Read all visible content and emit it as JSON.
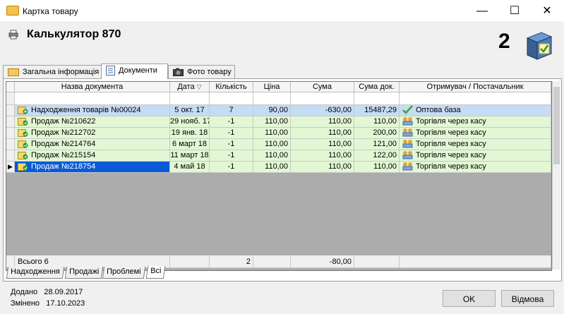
{
  "window": {
    "title": "Картка товару",
    "controls": {
      "minimize": "—",
      "maximize": "☐",
      "close": "✕"
    }
  },
  "product": {
    "name": "Калькулятор 870",
    "stock": "2"
  },
  "tabs": [
    {
      "label": "Загальна інформація",
      "icon": "folder-icon"
    },
    {
      "label": "Документи",
      "icon": "documents-icon",
      "active": true
    },
    {
      "label": "Фото товару",
      "icon": "camera-icon"
    }
  ],
  "grid": {
    "columns": [
      "Назва документа",
      "Дата",
      "Кількість",
      "Ціна",
      "Сума",
      "Сума док.",
      "Отримувач / Постачальник"
    ],
    "sort_indicator": "▽",
    "rows": [
      {
        "doc": "Надходження товарів №00024",
        "date": "5 окт. 17",
        "qty": "7",
        "price": "90,00",
        "sum": "-630,00",
        "doc_sum": "15487,29",
        "party": "Оптова база",
        "kind": "buy"
      },
      {
        "doc": "Продаж №210622",
        "date": "29 нояб. 17",
        "qty": "-1",
        "price": "110,00",
        "sum": "110,00",
        "doc_sum": "110,00",
        "party": "Торгівля через касу",
        "kind": "sale"
      },
      {
        "doc": "Продаж №212702",
        "date": "19 янв. 18",
        "qty": "-1",
        "price": "110,00",
        "sum": "110,00",
        "doc_sum": "200,00",
        "party": "Торгівля через касу",
        "kind": "sale"
      },
      {
        "doc": "Продаж №214764",
        "date": "6 март 18",
        "qty": "-1",
        "price": "110,00",
        "sum": "110,00",
        "doc_sum": "121,00",
        "party": "Торгівля через касу",
        "kind": "sale"
      },
      {
        "doc": "Продаж №215154",
        "date": "11 март 18",
        "qty": "-1",
        "price": "110,00",
        "sum": "110,00",
        "doc_sum": "122,00",
        "party": "Торгівля через касу",
        "kind": "sale"
      },
      {
        "doc": "Продаж №218754",
        "date": "4 май 18",
        "qty": "-1",
        "price": "110,00",
        "sum": "110,00",
        "doc_sum": "110,00",
        "party": "Торгівля через касу",
        "kind": "sel"
      }
    ],
    "current_row_marker": "▶",
    "footer": {
      "label": "Всього 6",
      "qty": "2",
      "sum": "-80,00"
    }
  },
  "subtabs": [
    {
      "label": "Надходження"
    },
    {
      "label": "Продажі"
    },
    {
      "label": "Проблемі"
    },
    {
      "label": "Всі",
      "active": true
    }
  ],
  "meta": {
    "added_label": "Додано",
    "added_date": "28.09.2017",
    "changed_label": "Змінено",
    "changed_date": "17.10.2023"
  },
  "buttons": {
    "ok": "OK",
    "cancel": "Відмова"
  },
  "colors": {
    "buy_row": "#c6dcf5",
    "sale_row": "#e2f8d4",
    "selection": "#0a5ad7"
  }
}
